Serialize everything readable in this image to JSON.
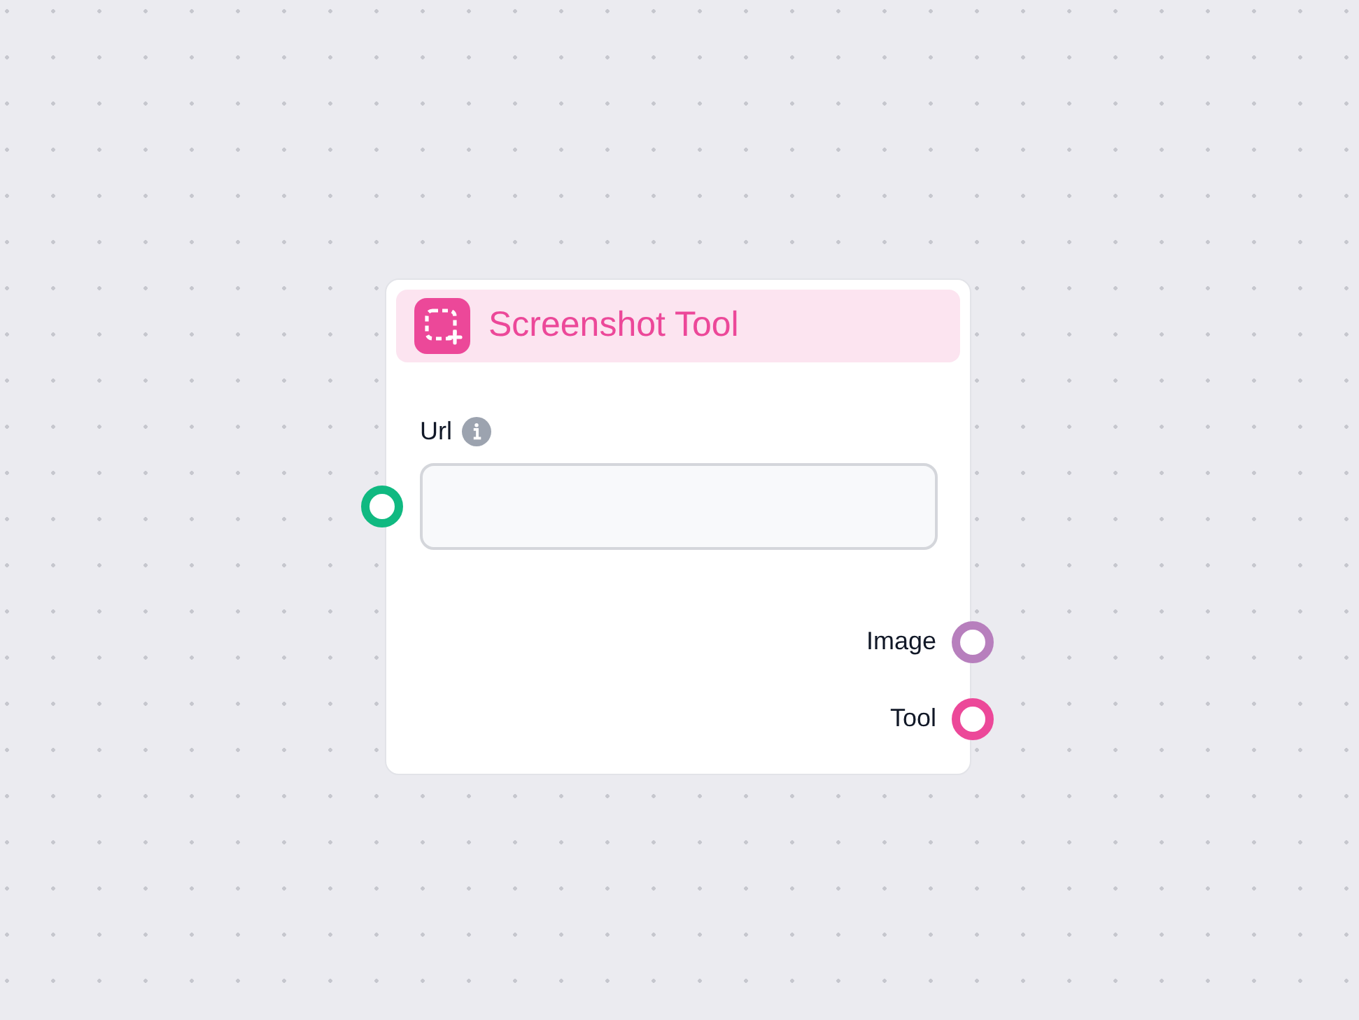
{
  "node": {
    "title": "Screenshot Tool",
    "inputs": [
      {
        "label": "Url",
        "color": "#10b981"
      }
    ],
    "outputs": [
      {
        "label": "Image",
        "color": "#b77fbd"
      },
      {
        "label": "Tool",
        "color": "#ec4899"
      }
    ]
  }
}
